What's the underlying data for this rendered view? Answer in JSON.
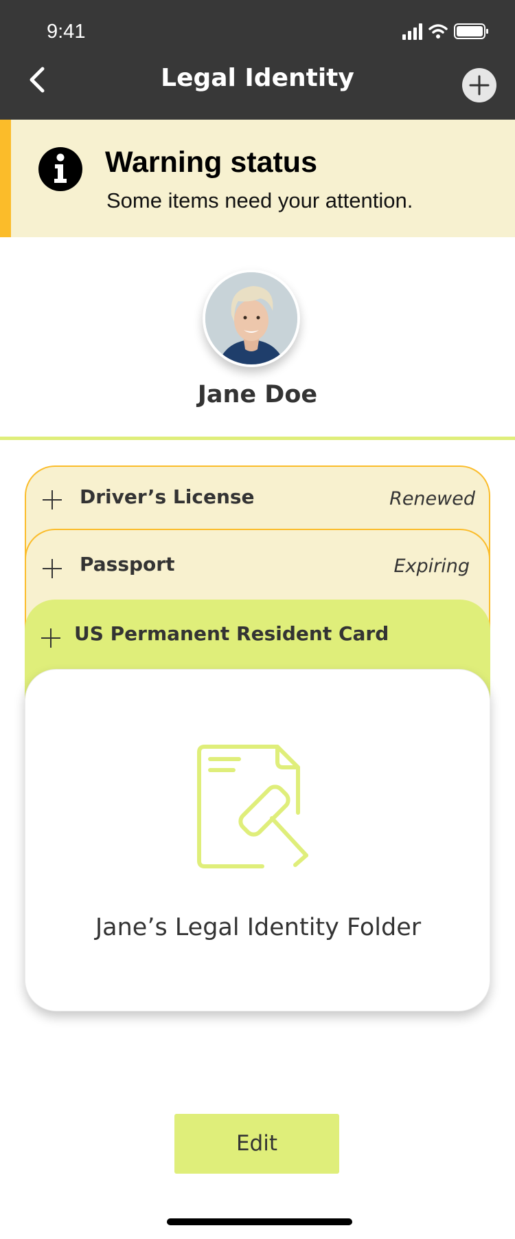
{
  "status_bar": {
    "time": "9:41"
  },
  "header": {
    "title": "Legal Identity",
    "back_icon": "chevron-left-icon",
    "add_icon": "plus-circle-icon"
  },
  "warning": {
    "title": "Warning status",
    "message": "Some items need your attention.",
    "icon": "info-icon",
    "bar_color": "#FBBC2A",
    "background": "#F7F1D0"
  },
  "profile": {
    "name": "Jane Doe"
  },
  "documents": [
    {
      "label": "Driver’s License",
      "status": "Renewed"
    },
    {
      "label": "Passport",
      "status": "Expiring"
    },
    {
      "label": "US Permanent Resident Card",
      "status": ""
    }
  ],
  "folder": {
    "title": "Jane’s Legal Identity Folder",
    "icon": "legal-document-gavel-icon"
  },
  "actions": {
    "edit_label": "Edit"
  },
  "colors": {
    "accent": "#DFEE7A",
    "header": "#383838"
  }
}
